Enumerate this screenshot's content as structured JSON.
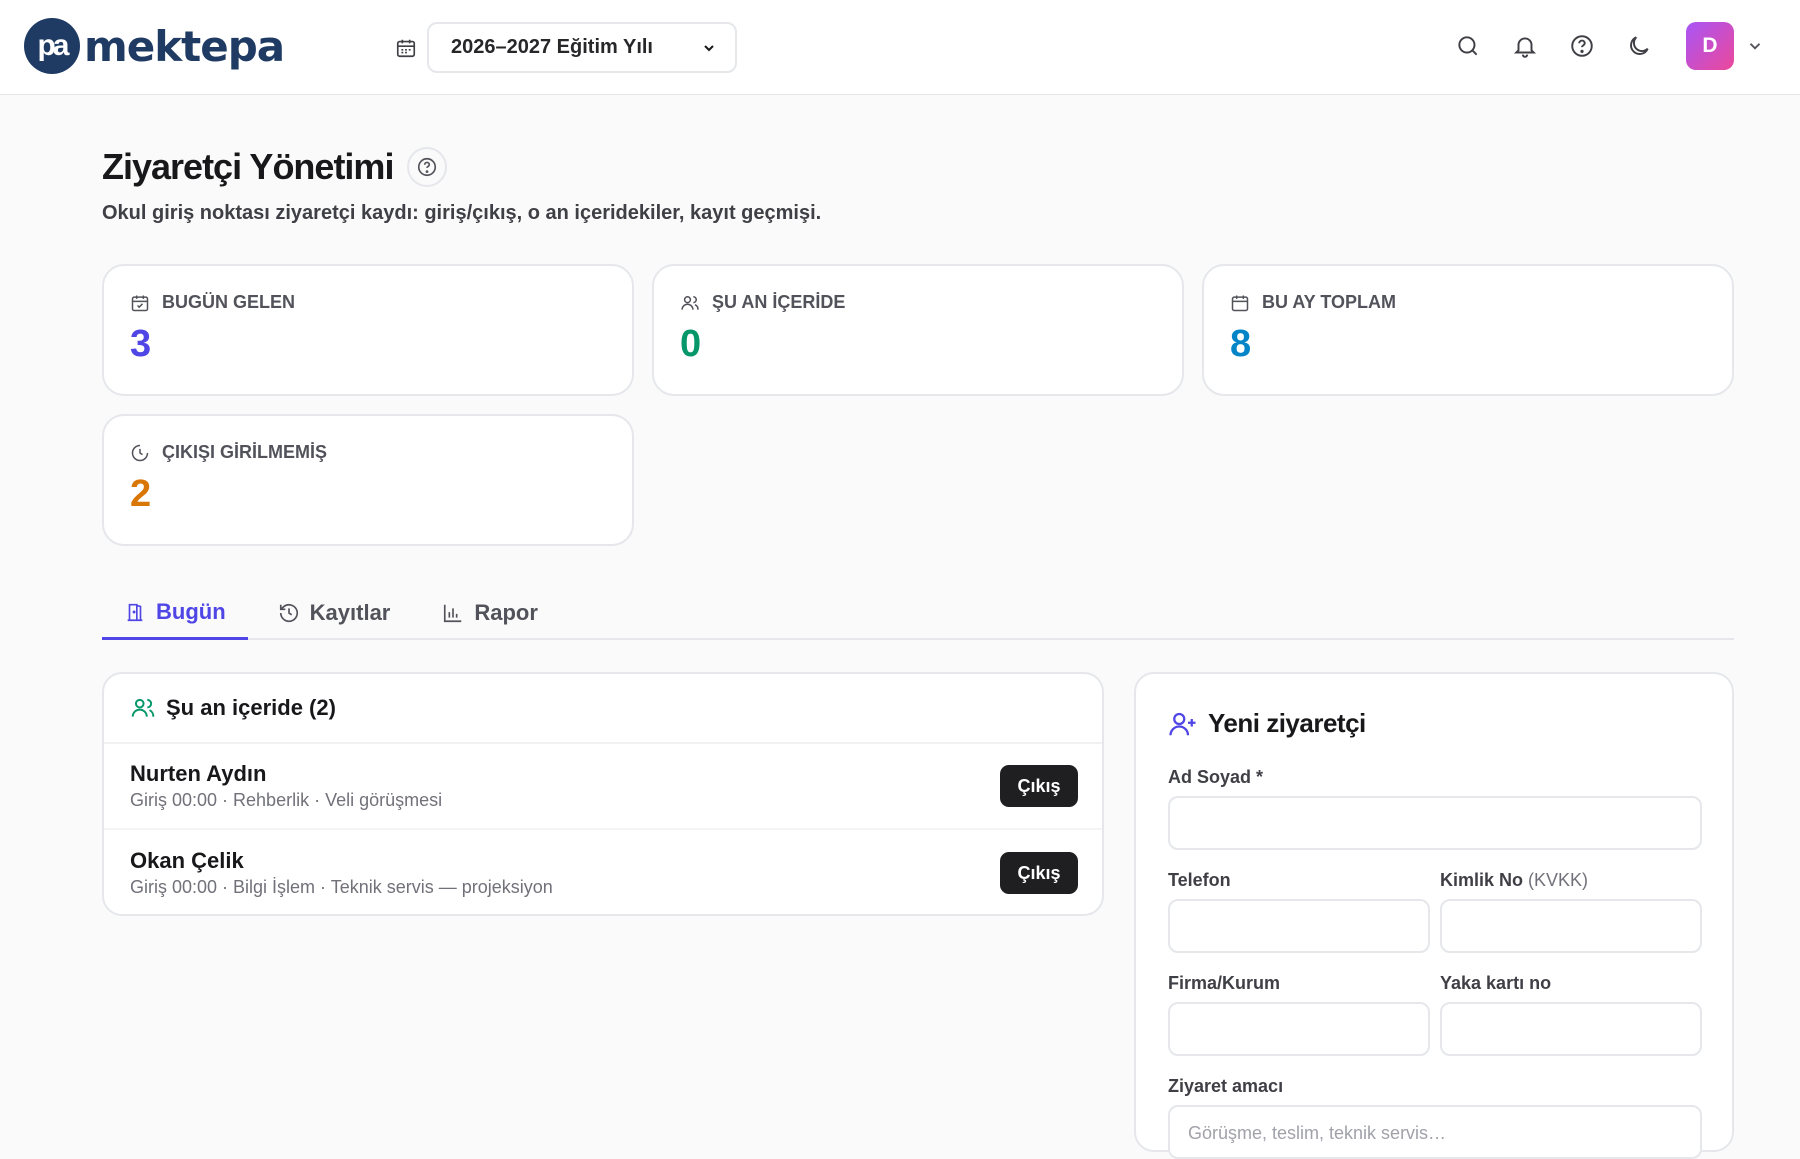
{
  "topbar": {
    "logo_mark": "pa",
    "logo_text": "mektepa",
    "year_select": "2026–2027 Eğitim Yılı",
    "avatar_initial": "D"
  },
  "page": {
    "title": "Ziyaretçi Yönetimi",
    "subtitle": "Okul giriş noktası ziyaretçi kaydı: giriş/çıkış, o an içeridekiler, kayıt geçmişi."
  },
  "stats": [
    {
      "label": "BUGÜN GELEN",
      "value": "3",
      "color": "#4f46e5"
    },
    {
      "label": "ŞU AN İÇERİDE",
      "value": "0",
      "color": "#059669"
    },
    {
      "label": "BU AY TOPLAM",
      "value": "8",
      "color": "#0284c7"
    },
    {
      "label": "ÇIKIŞI GİRİLMEMİŞ",
      "value": "2",
      "color": "#d97706"
    }
  ],
  "tabs": [
    {
      "label": "Bugün",
      "active": true
    },
    {
      "label": "Kayıtlar",
      "active": false
    },
    {
      "label": "Rapor",
      "active": false
    }
  ],
  "inside": {
    "title": "Şu an içeride (2)",
    "visitors": [
      {
        "name": "Nurten Aydın",
        "meta": "Giriş 00:00 · Rehberlik · Veli görüşmesi",
        "button": "Çıkış"
      },
      {
        "name": "Okan Çelik",
        "meta": "Giriş 00:00 · Bilgi İşlem · Teknik servis — projeksiyon",
        "button": "Çıkış"
      }
    ]
  },
  "new_visitor": {
    "title": "Yeni ziyaretçi",
    "fields": {
      "name_label": "Ad Soyad *",
      "phone_label": "Telefon",
      "id_label": "Kimlik No",
      "id_note": "(KVKK)",
      "company_label": "Firma/Kurum",
      "badge_label": "Yaka kartı no",
      "purpose_label": "Ziyaret amacı",
      "purpose_placeholder": "Görüşme, teslim, teknik servis…"
    }
  },
  "colors": {
    "accent": "#4f46e5",
    "brand": "#1f3b63"
  }
}
